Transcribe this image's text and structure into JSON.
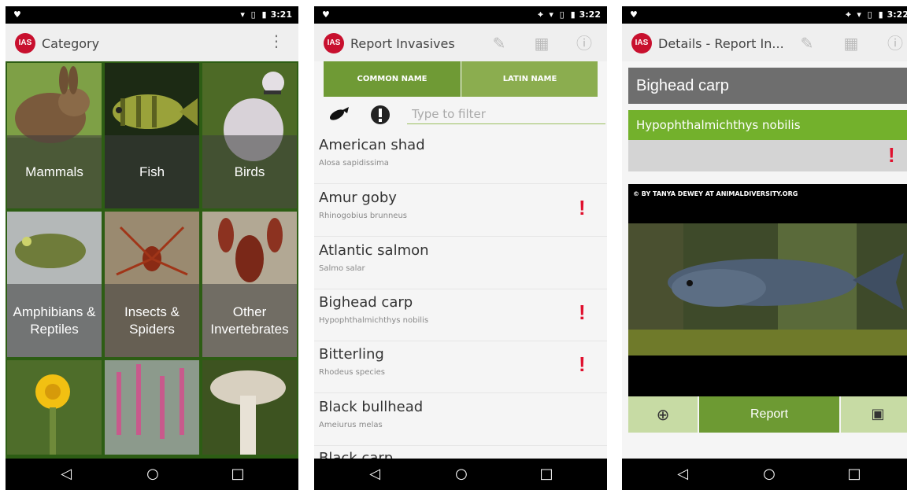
{
  "status": {
    "screen1_time": "3:21",
    "screen2_time": "3:22",
    "screen3_time": "3:22"
  },
  "category_screen": {
    "title": "Category",
    "logo": "IAS",
    "categories": [
      {
        "label": "Mammals"
      },
      {
        "label": "Fish"
      },
      {
        "label": "Birds"
      },
      {
        "label": "Amphibians & Reptiles"
      },
      {
        "label": "Insects & Spiders"
      },
      {
        "label": "Other Invertebrates"
      }
    ]
  },
  "list_screen": {
    "title": "Report Invasives",
    "logo": "IAS",
    "tabs": [
      {
        "label": "COMMON NAME"
      },
      {
        "label": "LATIN NAME"
      }
    ],
    "filter_placeholder": "Type to filter",
    "items": [
      {
        "common": "American shad",
        "latin": "Alosa sapidissima",
        "alert": ""
      },
      {
        "common": "Amur goby",
        "latin": "Rhinogobius brunneus",
        "alert": "!"
      },
      {
        "common": "Atlantic salmon",
        "latin": "Salmo salar",
        "alert": ""
      },
      {
        "common": "Bighead carp",
        "latin": "Hypophthalmichthys nobilis",
        "alert": "!"
      },
      {
        "common": "Bitterling",
        "latin": "Rhodeus species",
        "alert": "!"
      },
      {
        "common": "Black bullhead",
        "latin": "Ameiurus melas",
        "alert": ""
      },
      {
        "common": "Black carp",
        "latin": "",
        "alert": ""
      }
    ]
  },
  "details_screen": {
    "title": "Details - Report In...",
    "logo": "IAS",
    "common_name": "Bighead carp",
    "latin_name": "Hypophthalmichthys nobilis",
    "alert": "!",
    "photo_credit": "© BY TANYA DEWEY AT ANIMALDIVERSITY.ORG",
    "report_label": "Report"
  },
  "icons": {
    "zoom": "zoom-in-icon",
    "image": "image-icon",
    "edit": "pencil-icon",
    "map": "map-icon",
    "info": "info-icon"
  }
}
